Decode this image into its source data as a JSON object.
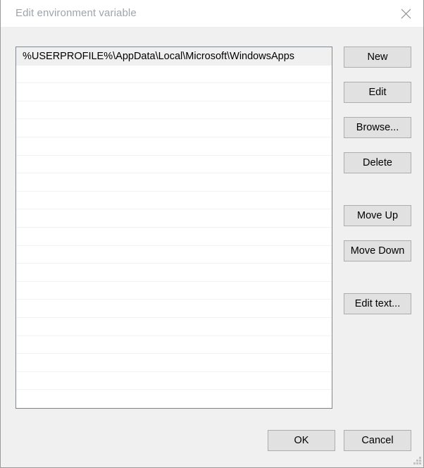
{
  "window": {
    "title": "Edit environment variable",
    "close_icon": "close-icon"
  },
  "list": {
    "rows": [
      {
        "value": "%USERPROFILE%\\AppData\\Local\\Microsoft\\WindowsApps",
        "selected": true
      },
      {
        "value": "",
        "selected": false
      },
      {
        "value": "",
        "selected": false
      },
      {
        "value": "",
        "selected": false
      },
      {
        "value": "",
        "selected": false
      },
      {
        "value": "",
        "selected": false
      },
      {
        "value": "",
        "selected": false
      },
      {
        "value": "",
        "selected": false
      },
      {
        "value": "",
        "selected": false
      },
      {
        "value": "",
        "selected": false
      },
      {
        "value": "",
        "selected": false
      },
      {
        "value": "",
        "selected": false
      },
      {
        "value": "",
        "selected": false
      },
      {
        "value": "",
        "selected": false
      },
      {
        "value": "",
        "selected": false
      },
      {
        "value": "",
        "selected": false
      },
      {
        "value": "",
        "selected": false
      },
      {
        "value": "",
        "selected": false
      },
      {
        "value": "",
        "selected": false
      },
      {
        "value": "",
        "selected": false
      }
    ]
  },
  "side_buttons": {
    "new": "New",
    "edit": "Edit",
    "browse": "Browse...",
    "delete": "Delete",
    "move_up": "Move Up",
    "move_down": "Move Down",
    "edit_text": "Edit text..."
  },
  "footer": {
    "ok": "OK",
    "cancel": "Cancel"
  },
  "colors": {
    "dialog_background": "#f0f0f0",
    "titlebar_background": "#ffffff",
    "title_text": "#9fa3ab",
    "listbox_background": "#ffffff",
    "listbox_border": "#828790",
    "row_separator": "#f2f2f2",
    "selected_row_background": "#f0f0f0",
    "button_face": "#e1e1e1",
    "button_border": "#adadad",
    "text": "#000000"
  }
}
